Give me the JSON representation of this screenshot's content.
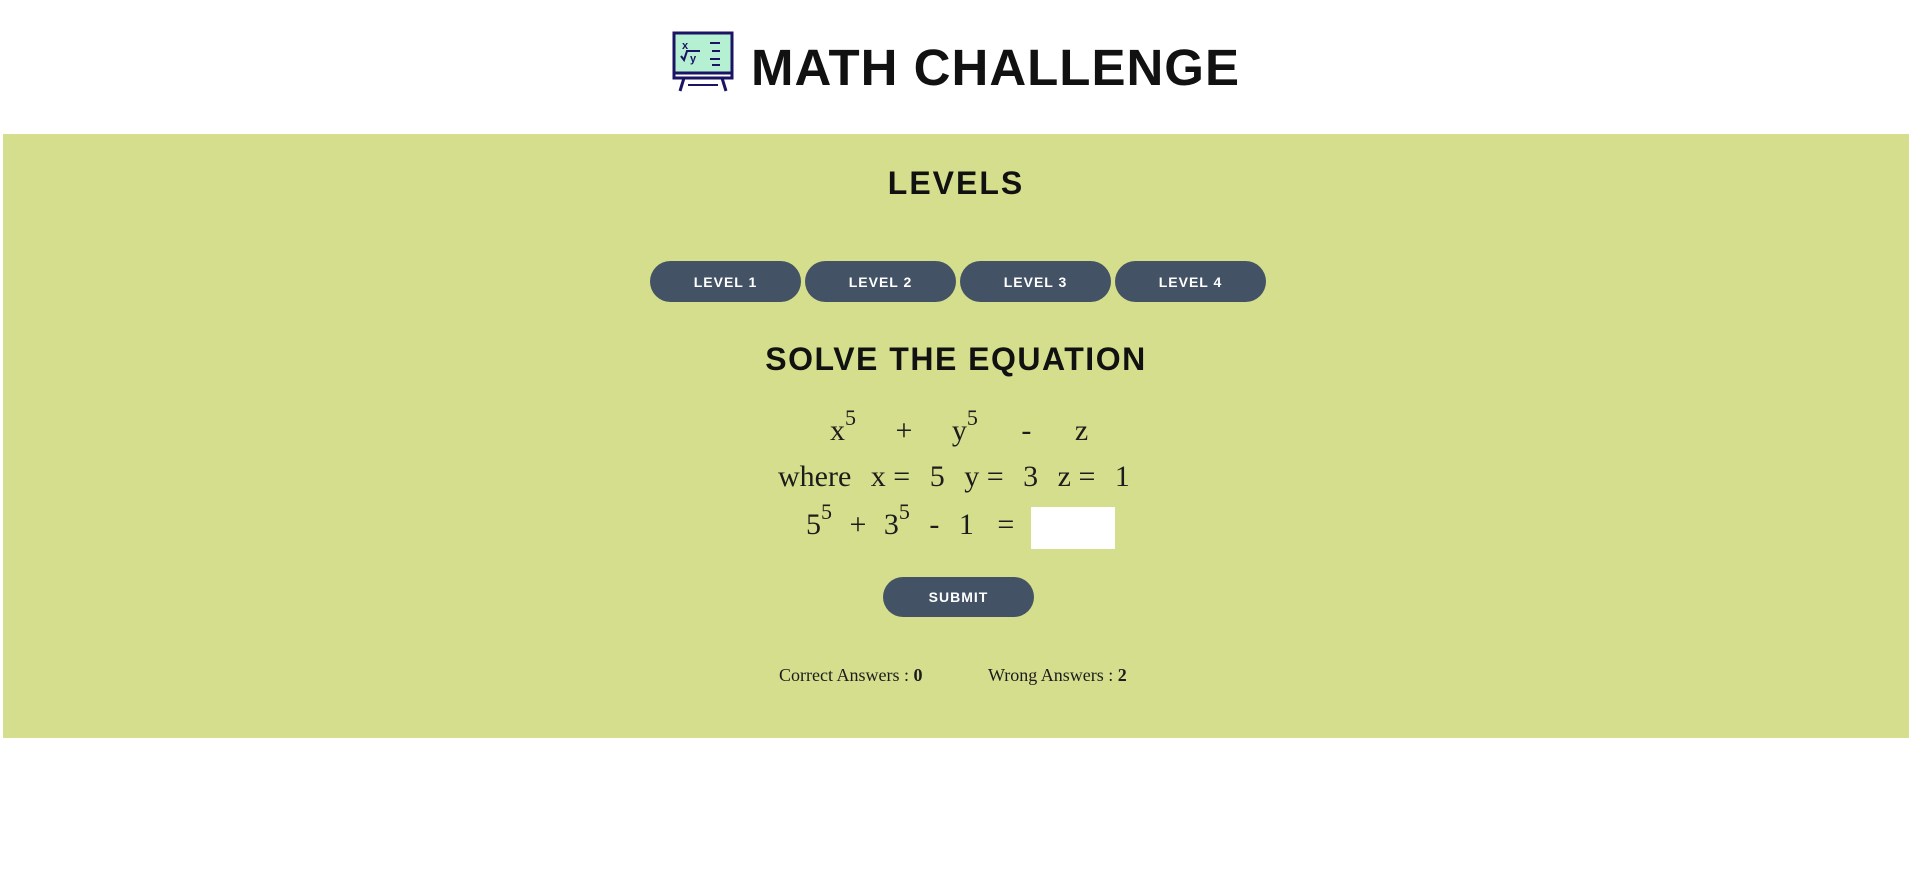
{
  "header": {
    "title": "MATH CHALLENGE",
    "logo_icon": "chalkboard-math-icon"
  },
  "levels": {
    "heading": "LEVELS",
    "buttons": [
      "LEVEL 1",
      "LEVEL 2",
      "LEVEL 3",
      "LEVEL 4"
    ]
  },
  "equation": {
    "heading": "SOLVE THE EQUATION",
    "line1": {
      "x": "x",
      "x_exp": "5",
      "plus": "+",
      "y": "y",
      "y_exp": "5",
      "minus": "-",
      "z": "z"
    },
    "line2": {
      "where": "where",
      "x_label": "x =",
      "x_val": "5",
      "y_label": "y =",
      "y_val": "3",
      "z_label": "z =",
      "z_val": "1"
    },
    "line3": {
      "a": "5",
      "a_exp": "5",
      "plus": "+",
      "b": "3",
      "b_exp": "5",
      "minus": "-",
      "c": "1",
      "equals": "="
    },
    "answer_value": ""
  },
  "submit_label": "SUBMIT",
  "score": {
    "correct_label": "Correct Answers :",
    "correct_value": "0",
    "wrong_label": "Wrong Answers :",
    "wrong_value": "2"
  },
  "colors": {
    "panel_bg": "#d5de8d",
    "button_bg": "#435264",
    "logo_screen": "#b5f0d2",
    "logo_frame": "#1b1464"
  }
}
